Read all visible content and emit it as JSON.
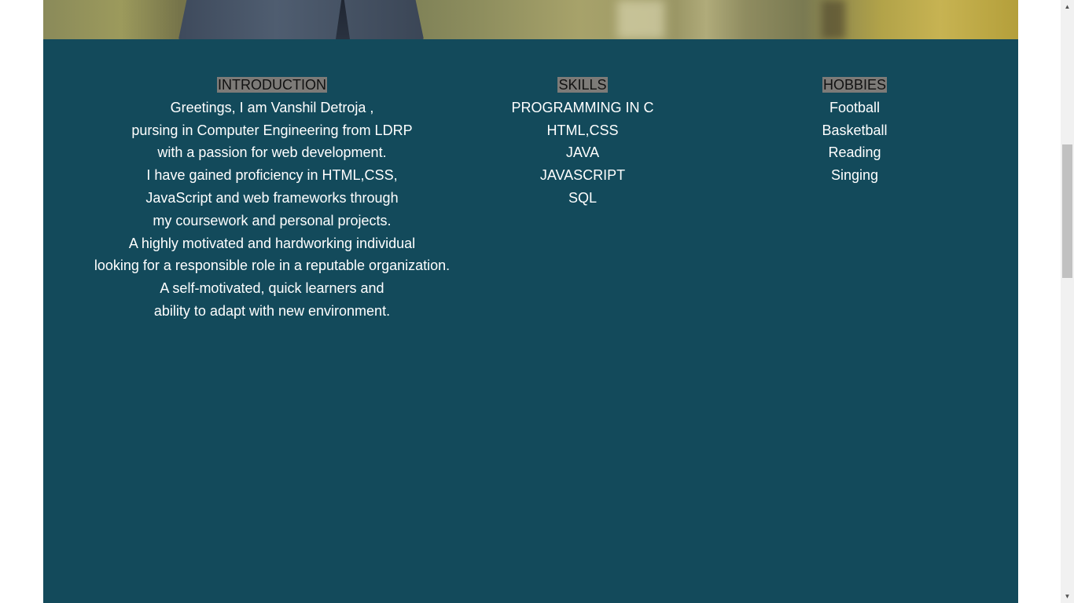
{
  "introduction": {
    "heading": "INTRODUCTION",
    "lines": [
      "Greetings, I am Vanshil Detroja ,",
      "pursing in Computer Engineering from LDRP",
      "with a passion for web development.",
      "I have gained proficiency in HTML,CSS,",
      "JavaScript and web frameworks through",
      "my coursework and personal projects.",
      "A highly motivated and hardworking individual",
      "looking for a responsible role in a reputable organization.",
      "A self-motivated, quick learners and",
      "ability to adapt with new environment."
    ]
  },
  "skills": {
    "heading": "SKILLS",
    "items": [
      "PROGRAMMING IN C",
      "HTML,CSS",
      "JAVA",
      "JAVASCRIPT",
      "SQL"
    ]
  },
  "hobbies": {
    "heading": "HOBBIES",
    "items": [
      "Football",
      "Basketball",
      "Reading",
      "Singing"
    ]
  },
  "scrollbar": {
    "up_icon": "triangle-up-icon",
    "down_icon": "triangle-down-icon"
  },
  "colors": {
    "panel_background": "#134a5b",
    "heading_highlight": "#7d7b78",
    "text": "#ffffff"
  }
}
